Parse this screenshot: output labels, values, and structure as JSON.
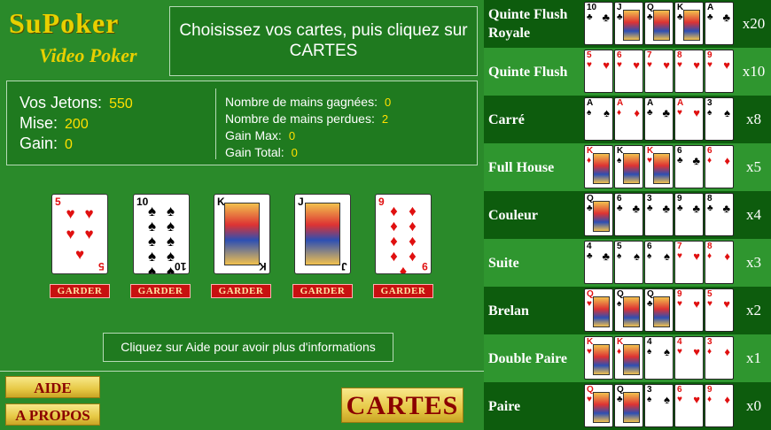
{
  "logo": {
    "title": "SuPoker",
    "subtitle": "Video Poker"
  },
  "message": "Choisissez vos cartes, puis cliquez sur CARTES",
  "stats": {
    "jetons_label": "Vos Jetons:",
    "jetons": "550",
    "mise_label": "Mise:",
    "mise": "200",
    "gain_label": "Gain:",
    "gain": "0",
    "gagnees_label": "Nombre de mains gagnées:",
    "gagnees": "0",
    "perdues_label": "Nombre de mains perdues:",
    "perdues": "2",
    "gainmax_label": "Gain Max:",
    "gainmax": "0",
    "gaintotal_label": "Gain Total:",
    "gaintotal": "0"
  },
  "hand": [
    {
      "rank": "5",
      "suit": "♥",
      "color": "red",
      "face": false
    },
    {
      "rank": "10",
      "suit": "♠",
      "color": "black",
      "face": false
    },
    {
      "rank": "K",
      "suit": "♣",
      "color": "black",
      "face": true
    },
    {
      "rank": "J",
      "suit": "♣",
      "color": "black",
      "face": true
    },
    {
      "rank": "9",
      "suit": "♦",
      "color": "red",
      "face": false
    }
  ],
  "garder_label": "GARDER",
  "help_text": "Cliquez sur Aide pour avoir plus d'informations",
  "buttons": {
    "aide": "AIDE",
    "apropos": "A PROPOS",
    "cartes": "CARTES"
  },
  "paytable": [
    {
      "name": "Quinte Flush Royale",
      "mult": "x20",
      "cards": [
        [
          "10",
          "♣"
        ],
        [
          "J",
          "♣"
        ],
        [
          "Q",
          "♣"
        ],
        [
          "K",
          "♣"
        ],
        [
          "A",
          "♣"
        ]
      ]
    },
    {
      "name": "Quinte Flush",
      "mult": "x10",
      "cards": [
        [
          "5",
          "♥"
        ],
        [
          "6",
          "♥"
        ],
        [
          "7",
          "♥"
        ],
        [
          "8",
          "♥"
        ],
        [
          "9",
          "♥"
        ]
      ]
    },
    {
      "name": "Carré",
      "mult": "x8",
      "cards": [
        [
          "A",
          "♠"
        ],
        [
          "A",
          "♦"
        ],
        [
          "A",
          "♣"
        ],
        [
          "A",
          "♥"
        ],
        [
          "3",
          "♠"
        ]
      ]
    },
    {
      "name": "Full House",
      "mult": "x5",
      "cards": [
        [
          "K",
          "♦"
        ],
        [
          "K",
          "♠"
        ],
        [
          "K",
          "♥"
        ],
        [
          "6",
          "♣"
        ],
        [
          "6",
          "♦"
        ]
      ]
    },
    {
      "name": "Couleur",
      "mult": "x4",
      "cards": [
        [
          "Q",
          "♣"
        ],
        [
          "6",
          "♣"
        ],
        [
          "3",
          "♣"
        ],
        [
          "9",
          "♣"
        ],
        [
          "8",
          "♣"
        ]
      ]
    },
    {
      "name": "Suite",
      "mult": "x3",
      "cards": [
        [
          "4",
          "♣"
        ],
        [
          "5",
          "♠"
        ],
        [
          "6",
          "♠"
        ],
        [
          "7",
          "♥"
        ],
        [
          "8",
          "♦"
        ]
      ]
    },
    {
      "name": "Brelan",
      "mult": "x2",
      "cards": [
        [
          "Q",
          "♥"
        ],
        [
          "Q",
          "♠"
        ],
        [
          "Q",
          "♣"
        ],
        [
          "9",
          "♥"
        ],
        [
          "5",
          "♥"
        ]
      ]
    },
    {
      "name": "Double Paire",
      "mult": "x1",
      "cards": [
        [
          "K",
          "♥"
        ],
        [
          "K",
          "♦"
        ],
        [
          "4",
          "♠"
        ],
        [
          "4",
          "♥"
        ],
        [
          "3",
          "♦"
        ]
      ]
    },
    {
      "name": "Paire",
      "mult": "x0",
      "cards": [
        [
          "Q",
          "♥"
        ],
        [
          "Q",
          "♣"
        ],
        [
          "3",
          "♠"
        ],
        [
          "6",
          "♥"
        ],
        [
          "9",
          "♦"
        ]
      ]
    }
  ]
}
